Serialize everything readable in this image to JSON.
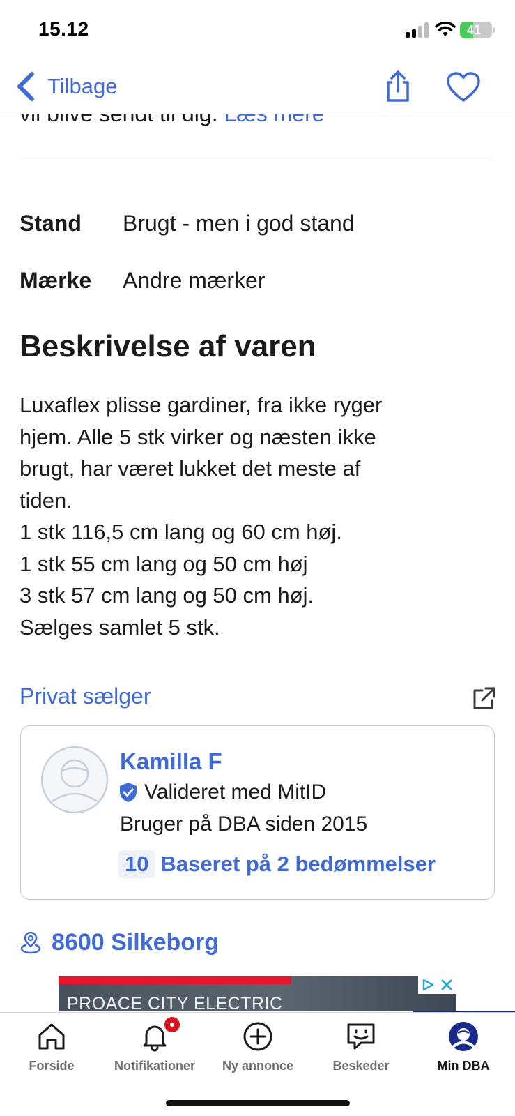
{
  "status_bar": {
    "time": "15.12",
    "battery_percent": "41"
  },
  "header": {
    "back_label": "Tilbage",
    "share_icon": "share-icon",
    "favorite_icon": "heart-icon"
  },
  "truncated_text": {
    "text": "vil blive sendt til dig.",
    "link": "Læs mere"
  },
  "attributes": [
    {
      "key": "Stand",
      "value": "Brugt - men i god stand"
    },
    {
      "key": "Mærke",
      "value": "Andre mærker"
    }
  ],
  "description": {
    "title": "Beskrivelse af varen",
    "lines": [
      "Luxaflex plisse gardiner, fra ikke ryger",
      "hjem. Alle 5 stk virker og næsten ikke",
      "brugt, har været lukket det meste af",
      "tiden.",
      "1 stk 116,5 cm lang og 60 cm høj.",
      "1 stk 55 cm lang og 50 cm høj",
      "3 stk 57 cm lang og 50 cm høj.",
      "Sælges samlet 5 stk."
    ]
  },
  "seller": {
    "type_label": "Privat sælger",
    "name": "Kamilla F",
    "verified_text": "Valideret med MitID",
    "member_since": "Bruger på DBA siden 2015",
    "rating_score": "10",
    "rating_text": "Baseret på 2 bedømmelser"
  },
  "location": {
    "text": "8600 Silkeborg"
  },
  "ad": {
    "text": "PROACE CITY ELECTRIC"
  },
  "tabs": [
    {
      "label": "Forside",
      "icon": "home-icon"
    },
    {
      "label": "Notifikationer",
      "icon": "bell-icon"
    },
    {
      "label": "Ny annonce",
      "icon": "plus-circle-icon"
    },
    {
      "label": "Beskeder",
      "icon": "chat-icon"
    },
    {
      "label": "Min DBA",
      "icon": "profile-icon",
      "active": true
    }
  ],
  "colors": {
    "accent": "#3f6ad8",
    "text": "#1b1b1b",
    "badge": "#d8141f"
  }
}
